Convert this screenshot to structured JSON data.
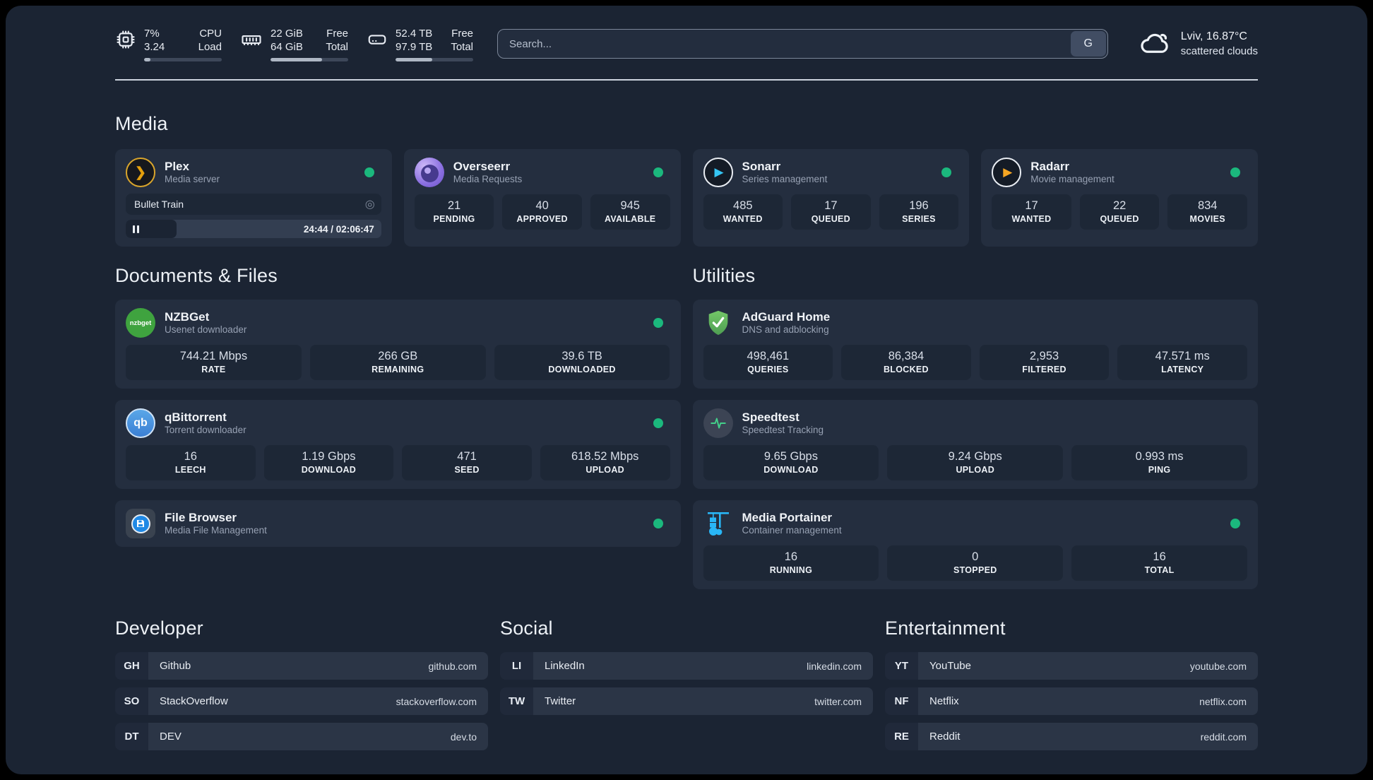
{
  "colors": {
    "status_online": "#1bb87d",
    "accent_amber": "#e5a00d",
    "accent_blue": "#35c5f4",
    "accent_green_shield": "#5fae57",
    "portainer_blue": "#29b6f6"
  },
  "header": {
    "stats": [
      {
        "icon": "cpu-icon",
        "values": [
          "7%",
          "3.24"
        ],
        "labels": [
          "CPU",
          "Load"
        ],
        "progress": 8
      },
      {
        "icon": "ram-icon",
        "values": [
          "22 GiB",
          "64 GiB"
        ],
        "labels": [
          "Free",
          "Total"
        ],
        "progress": 66
      },
      {
        "icon": "disk-icon",
        "values": [
          "52.4 TB",
          "97.9 TB"
        ],
        "labels": [
          "Free",
          "Total"
        ],
        "progress": 47
      }
    ],
    "search": {
      "placeholder": "Search...",
      "button_label": "G"
    },
    "weather": {
      "icon": "cloud-icon",
      "location": "Lviv, 16.87°C",
      "condition": "scattered clouds"
    }
  },
  "sections": {
    "media": {
      "title": "Media",
      "plex": {
        "icon": "plex-icon",
        "icon_glyph": "❯",
        "name": "Plex",
        "subtitle": "Media server",
        "online": true,
        "now_playing": {
          "title": "Bullet Train",
          "target_glyph": "◎",
          "state": "paused",
          "progress": 20,
          "time_display": "24:44 / 02:06:47"
        }
      },
      "overseerr": {
        "icon": "overseerr-icon",
        "name": "Overseerr",
        "subtitle": "Media Requests",
        "online": true,
        "stats": [
          {
            "value": "21",
            "label": "PENDING"
          },
          {
            "value": "40",
            "label": "APPROVED"
          },
          {
            "value": "945",
            "label": "AVAILABLE"
          }
        ]
      },
      "sonarr": {
        "icon": "sonarr-icon",
        "icon_glyph": "▶",
        "name": "Sonarr",
        "subtitle": "Series management",
        "online": true,
        "stats": [
          {
            "value": "485",
            "label": "WANTED"
          },
          {
            "value": "17",
            "label": "QUEUED"
          },
          {
            "value": "196",
            "label": "SERIES"
          }
        ]
      },
      "radarr": {
        "icon": "radarr-icon",
        "icon_glyph": "▶",
        "name": "Radarr",
        "subtitle": "Movie management",
        "online": true,
        "stats": [
          {
            "value": "17",
            "label": "WANTED"
          },
          {
            "value": "22",
            "label": "QUEUED"
          },
          {
            "value": "834",
            "label": "MOVIES"
          }
        ]
      }
    },
    "documents": {
      "title": "Documents & Files",
      "nzbget": {
        "icon": "nzbget-icon",
        "icon_glyph": "nzbget",
        "name": "NZBGet",
        "subtitle": "Usenet downloader",
        "online": true,
        "stats": [
          {
            "value": "744.21 Mbps",
            "label": "RATE"
          },
          {
            "value": "266 GB",
            "label": "REMAINING"
          },
          {
            "value": "39.6 TB",
            "label": "DOWNLOADED"
          }
        ]
      },
      "qbittorrent": {
        "icon": "qbittorrent-icon",
        "icon_glyph": "qb",
        "name": "qBittorrent",
        "subtitle": "Torrent downloader",
        "online": true,
        "stats": [
          {
            "value": "16",
            "label": "LEECH"
          },
          {
            "value": "1.19 Gbps",
            "label": "DOWNLOAD"
          },
          {
            "value": "471",
            "label": "SEED"
          },
          {
            "value": "618.52 Mbps",
            "label": "UPLOAD"
          }
        ]
      },
      "filebrowser": {
        "icon": "filebrowser-icon",
        "name": "File Browser",
        "subtitle": "Media File Management",
        "online": true
      }
    },
    "utilities": {
      "title": "Utilities",
      "adguard": {
        "icon": "adguard-shield-icon",
        "name": "AdGuard Home",
        "subtitle": "DNS and adblocking",
        "stats": [
          {
            "value": "498,461",
            "label": "QUERIES"
          },
          {
            "value": "86,384",
            "label": "BLOCKED"
          },
          {
            "value": "2,953",
            "label": "FILTERED"
          },
          {
            "value": "47.571 ms",
            "label": "LATENCY"
          }
        ]
      },
      "speedtest": {
        "icon": "speedtest-pulse-icon",
        "name": "Speedtest",
        "subtitle": "Speedtest Tracking",
        "stats": [
          {
            "value": "9.65 Gbps",
            "label": "DOWNLOAD"
          },
          {
            "value": "9.24 Gbps",
            "label": "UPLOAD"
          },
          {
            "value": "0.993 ms",
            "label": "PING"
          }
        ]
      },
      "portainer": {
        "icon": "portainer-icon",
        "name": "Media Portainer",
        "subtitle": "Container management",
        "online": true,
        "stats": [
          {
            "value": "16",
            "label": "RUNNING"
          },
          {
            "value": "0",
            "label": "STOPPED"
          },
          {
            "value": "16",
            "label": "TOTAL"
          }
        ]
      }
    },
    "links": {
      "developer": {
        "title": "Developer",
        "items": [
          {
            "abbr": "GH",
            "name": "Github",
            "url": "github.com"
          },
          {
            "abbr": "SO",
            "name": "StackOverflow",
            "url": "stackoverflow.com"
          },
          {
            "abbr": "DT",
            "name": "DEV",
            "url": "dev.to"
          }
        ]
      },
      "social": {
        "title": "Social",
        "items": [
          {
            "abbr": "LI",
            "name": "LinkedIn",
            "url": "linkedin.com"
          },
          {
            "abbr": "TW",
            "name": "Twitter",
            "url": "twitter.com"
          }
        ]
      },
      "entertainment": {
        "title": "Entertainment",
        "items": [
          {
            "abbr": "YT",
            "name": "YouTube",
            "url": "youtube.com"
          },
          {
            "abbr": "NF",
            "name": "Netflix",
            "url": "netflix.com"
          },
          {
            "abbr": "RE",
            "name": "Reddit",
            "url": "reddit.com"
          }
        ]
      }
    }
  }
}
